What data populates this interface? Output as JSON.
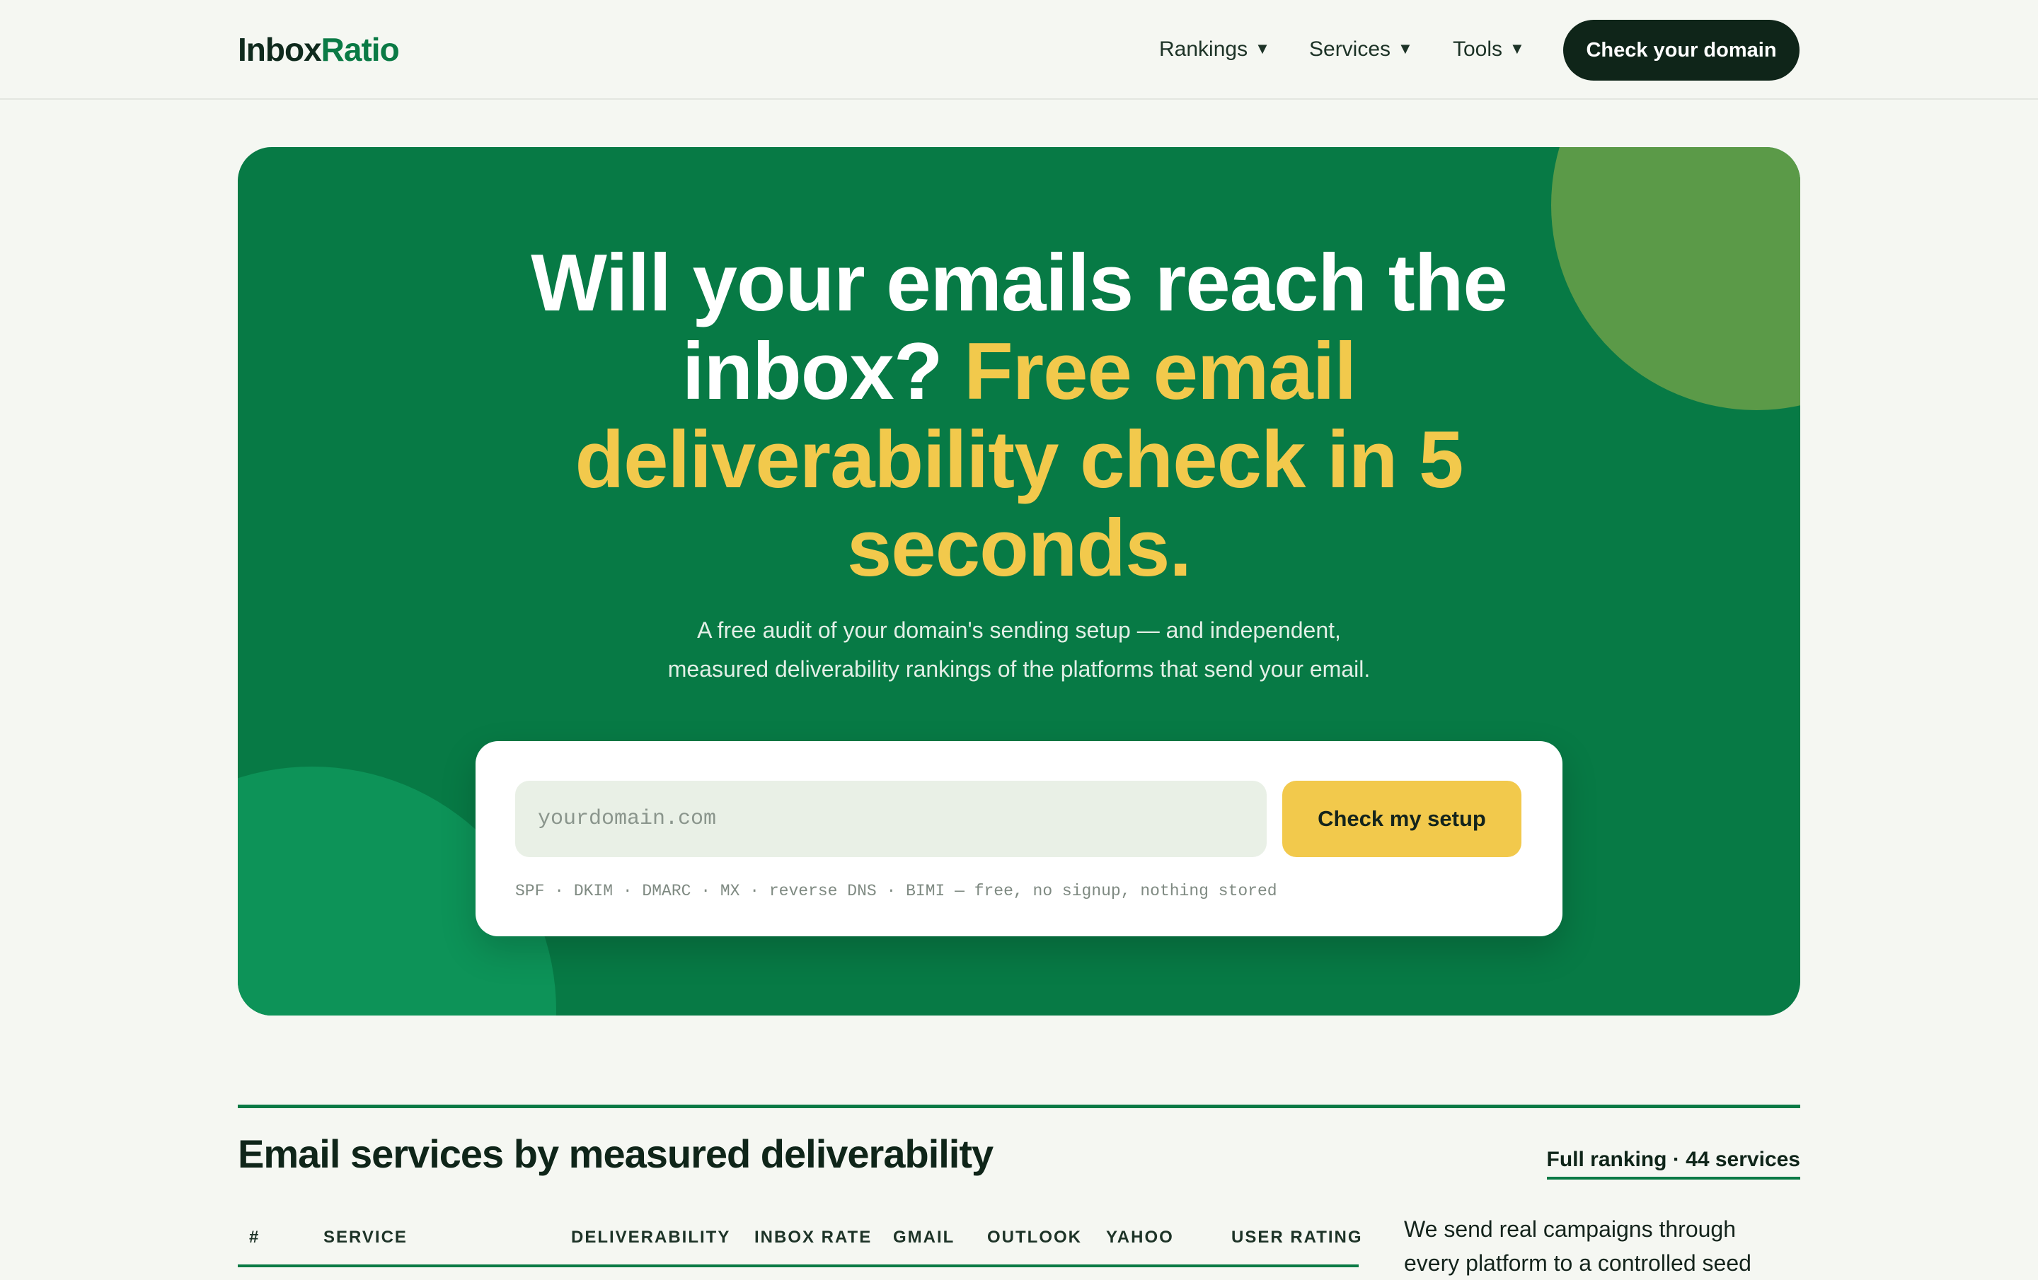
{
  "header": {
    "logo_part1": "Inbox",
    "logo_part2": "Ratio",
    "nav": [
      {
        "label": "Rankings",
        "caret": "▼"
      },
      {
        "label": "Services",
        "caret": "▼"
      },
      {
        "label": "Tools",
        "caret": "▼"
      }
    ],
    "cta_label": "Check your domain"
  },
  "hero": {
    "title_white": "Will your emails reach the inbox?",
    "title_highlight": "Free email deliverability check in 5 seconds.",
    "subtitle_line1": "A free audit of your domain's sending setup — and independent,",
    "subtitle_line2": "measured deliverability rankings of the platforms that send your email."
  },
  "form": {
    "placeholder": "yourdomain.com",
    "value": "",
    "submit_label": "Check my setup",
    "note": "SPF · DKIM · DMARC · MX · reverse DNS · BIMI — free, no signup, nothing stored"
  },
  "rankings": {
    "title": "Email services by measured deliverability",
    "full_ranking_link": "Full ranking · 44 services",
    "columns": [
      "#",
      "SERVICE",
      "DELIVERABILITY",
      "INBOX RATE",
      "GMAIL",
      "OUTLOOK",
      "YAHOO",
      "USER RATING"
    ],
    "side_text_line1": "We send real campaigns through",
    "side_text_line2": "every platform to a controlled seed"
  },
  "colors": {
    "brand_green": "#077a45",
    "accent_yellow": "#f2c94c",
    "dark": "#0f2519",
    "background": "#f5f7f2"
  }
}
